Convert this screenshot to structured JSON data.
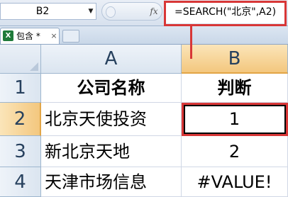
{
  "formula_bar": {
    "name_box": "B2",
    "fx_label": "fx",
    "formula": "=SEARCH(\"北京\",A2)"
  },
  "tabs": [
    {
      "label": "包含 *",
      "close": "×",
      "icon": "X"
    }
  ],
  "sheet": {
    "columns": [
      "A",
      "B"
    ],
    "rows": [
      {
        "row": "1",
        "a": "公司名称",
        "b": "判断"
      },
      {
        "row": "2",
        "a": "北京天使投资",
        "b": "1"
      },
      {
        "row": "3",
        "a": "新北京天地",
        "b": "2"
      },
      {
        "row": "4",
        "a": "天津市场信息",
        "b": "#VALUE!"
      }
    ]
  },
  "colors": {
    "highlight": "#d83737",
    "selected_header": "#f3c77e"
  }
}
